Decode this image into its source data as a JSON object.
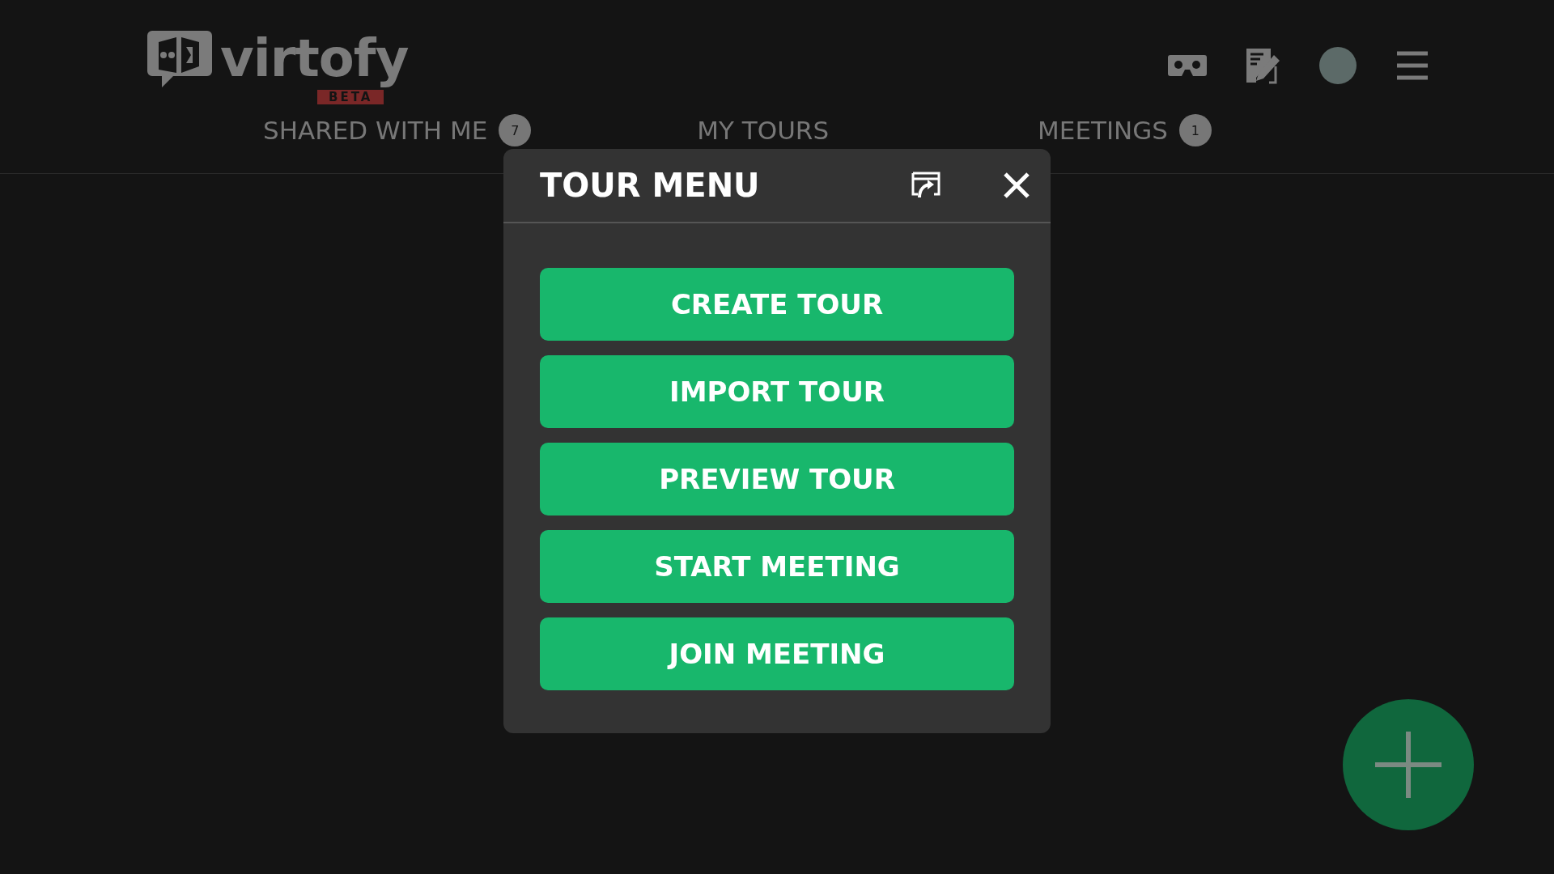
{
  "logo": {
    "name": "virtofy",
    "tag": "BETA"
  },
  "tabs": [
    {
      "label": "SHARED WITH ME",
      "badge": "7"
    },
    {
      "label": "MY TOURS"
    },
    {
      "label": "MEETINGS",
      "badge": "1"
    }
  ],
  "dialog": {
    "title": "TOUR MENU",
    "buttons": [
      "CREATE TOUR",
      "IMPORT TOUR",
      "PREVIEW TOUR",
      "START MEETING",
      "JOIN MEETING"
    ]
  }
}
